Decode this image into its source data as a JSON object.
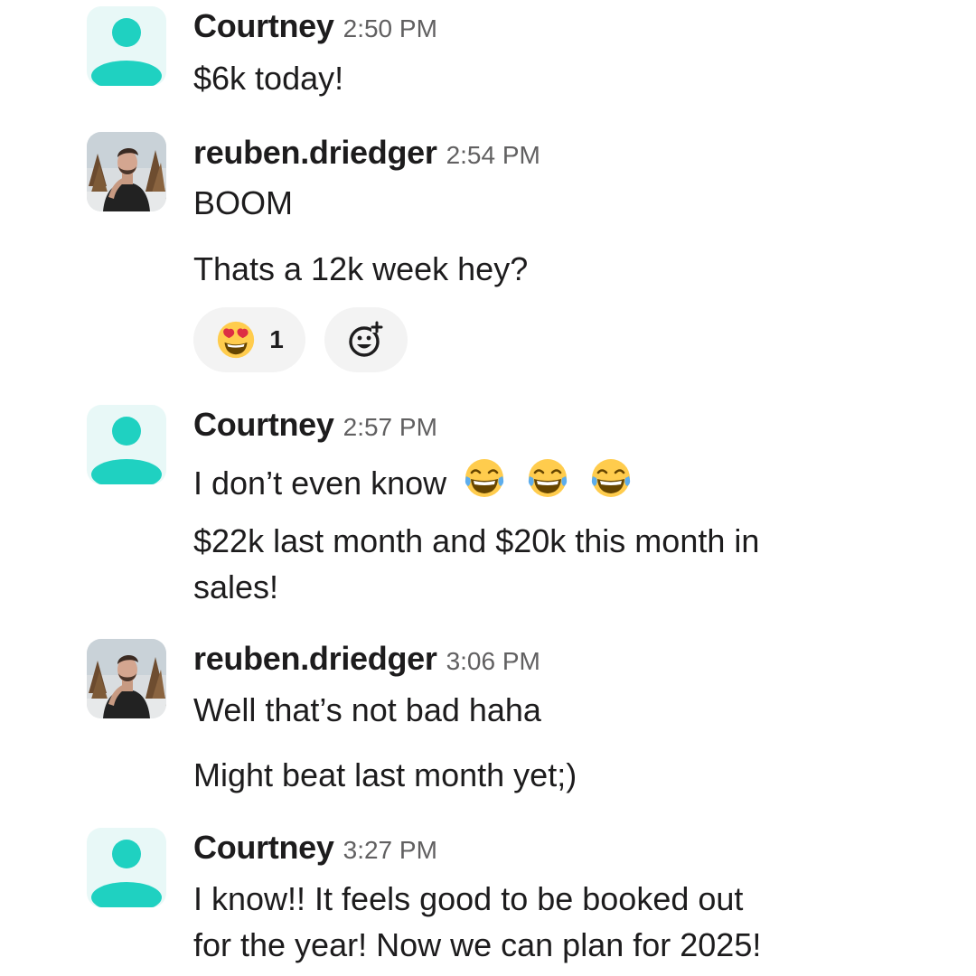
{
  "colors": {
    "avatar_bg": "#e8f8f7",
    "avatar_figure": "#1fd1c1",
    "timestamp": "#616061",
    "reaction_bg": "#f3f3f3"
  },
  "messages": [
    {
      "author": "Courtney",
      "time": "2:50 PM",
      "avatar": "default-user-icon",
      "lines": [
        "$6k today!"
      ]
    },
    {
      "author": "reuben.driedger",
      "time": "2:54 PM",
      "avatar": "profile-photo",
      "lines": [
        "BOOM",
        "Thats a 12k week hey?"
      ],
      "reactions": [
        {
          "icon": "heart-eyes-emoji",
          "count": "1"
        }
      ],
      "add_reaction_icon": "add-reaction-icon"
    },
    {
      "author": "Courtney",
      "time": "2:57 PM",
      "avatar": "default-user-icon",
      "lines": [
        "I don’t even know",
        "$22k last month and $20k this month in",
        "sales!"
      ],
      "inline_emoji": [
        "laughing-tears-emoji",
        "laughing-tears-emoji",
        "laughing-tears-emoji"
      ]
    },
    {
      "author": "reuben.driedger",
      "time": "3:06 PM",
      "avatar": "profile-photo",
      "lines": [
        "Well that’s not bad haha",
        "Might beat last month yet;)"
      ]
    },
    {
      "author": "Courtney",
      "time": "3:27 PM",
      "avatar": "default-user-icon",
      "lines": [
        "I know!! It feels good to be booked out",
        "for the year! Now we can plan for 2025!"
      ]
    }
  ]
}
